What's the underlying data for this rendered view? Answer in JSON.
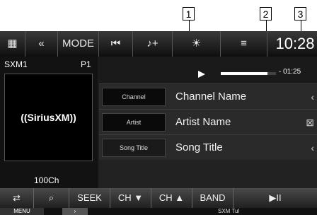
{
  "callouts": [
    "1",
    "2",
    "3"
  ],
  "topbar": {
    "icons": [
      "app-icon",
      "back-icon"
    ],
    "mode_label": "MODE",
    "items": [
      "⏮",
      "♪+",
      "☀",
      "≡"
    ],
    "time": "10:28"
  },
  "left": {
    "station": "SXM1",
    "preset": "P1",
    "logo_text": "((SiriusXM))",
    "channel_number": "100Ch"
  },
  "progress": {
    "elapsed_fraction": 0.85,
    "remaining": "- 01:25"
  },
  "rows": [
    {
      "label": "Channel",
      "value": "Channel Name",
      "icon": "‹"
    },
    {
      "label": "Artist",
      "value": "Artist Name",
      "icon": "⊠"
    },
    {
      "label": "Song Title",
      "value": "Song Title",
      "icon": "‹"
    }
  ],
  "controls": {
    "seek": "SEEK",
    "ch_down": "CH ▼",
    "ch_up": "CH ▲",
    "band": "BAND",
    "playpause": "▶II"
  },
  "bottom": {
    "menu": "MENU",
    "label": "SXM Tul"
  },
  "colors": {
    "background": "#1c1c1c",
    "accent": "#ffffff"
  }
}
